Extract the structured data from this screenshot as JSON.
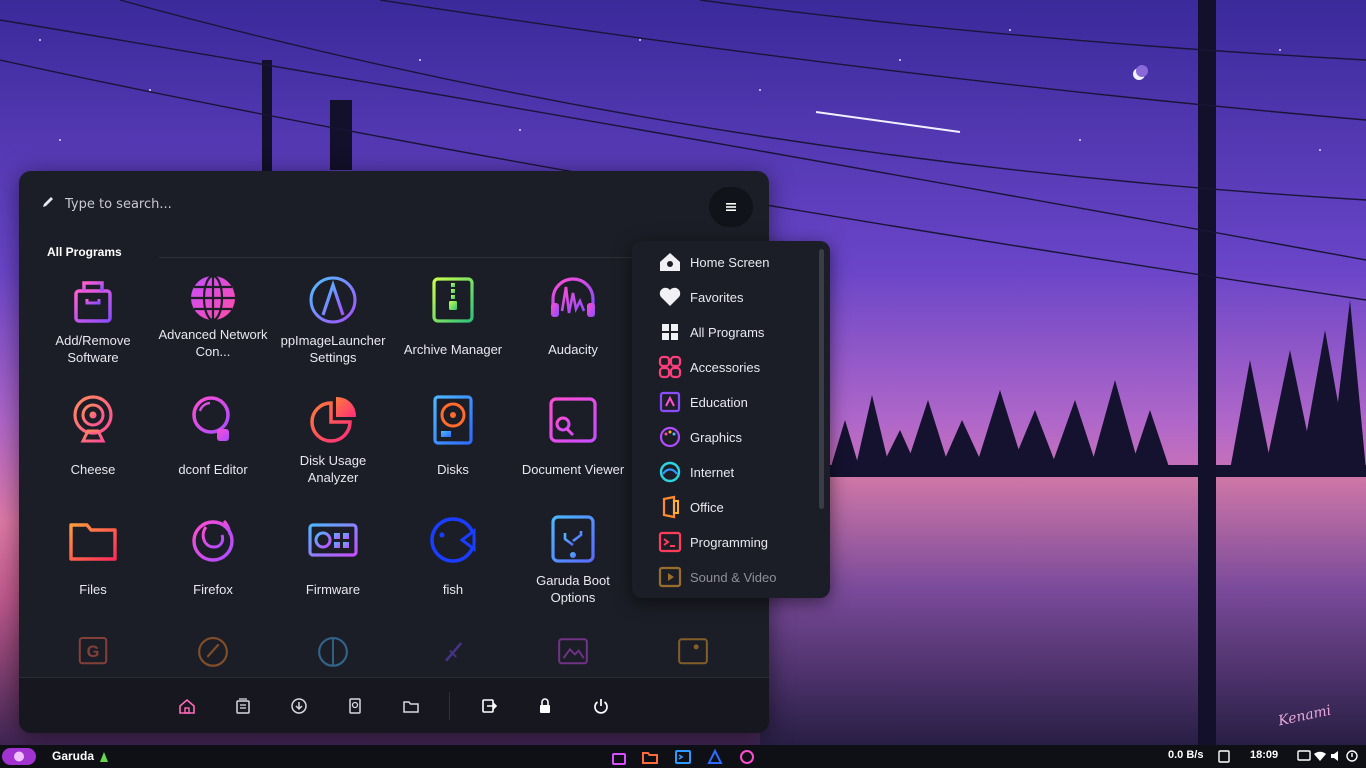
{
  "search": {
    "placeholder": "Type to search..."
  },
  "section": {
    "title": "All Programs"
  },
  "apps": [
    {
      "label": "Add/Remove Software",
      "icon": "package-bag-icon"
    },
    {
      "label": "Advanced Network Con...",
      "icon": "globe-icon"
    },
    {
      "label": "ppImageLauncher Settings",
      "icon": "appimage-a-icon"
    },
    {
      "label": "Archive Manager",
      "icon": "archive-zip-icon"
    },
    {
      "label": "Audacity",
      "icon": "headphones-waveform-icon"
    },
    {
      "label": "Cheese",
      "icon": "webcam-icon"
    },
    {
      "label": "dconf Editor",
      "icon": "dconf-magnifier-icon"
    },
    {
      "label": "Disk Usage Analyzer",
      "icon": "pie-chart-icon"
    },
    {
      "label": "Disks",
      "icon": "hard-disk-icon"
    },
    {
      "label": "Document Viewer",
      "icon": "document-viewer-icon"
    },
    {
      "label": "Files",
      "icon": "folder-icon"
    },
    {
      "label": "Firefox",
      "icon": "firefox-icon"
    },
    {
      "label": "Firmware",
      "icon": "firmware-chip-icon"
    },
    {
      "label": "fish",
      "icon": "fish-icon"
    },
    {
      "label": "Garuda Boot Options",
      "icon": "usb-boot-icon"
    }
  ],
  "categories": [
    {
      "label": "Home Screen",
      "icon": "home-icon"
    },
    {
      "label": "Favorites",
      "icon": "heart-icon"
    },
    {
      "label": "All Programs",
      "icon": "grid-icon"
    },
    {
      "label": "Accessories",
      "icon": "accessories-icon"
    },
    {
      "label": "Education",
      "icon": "education-icon"
    },
    {
      "label": "Graphics",
      "icon": "palette-icon"
    },
    {
      "label": "Internet",
      "icon": "internet-icon"
    },
    {
      "label": "Office",
      "icon": "office-icon"
    },
    {
      "label": "Programming",
      "icon": "terminal-icon"
    },
    {
      "label": "Sound & Video",
      "icon": "media-player-icon"
    }
  ],
  "bottom_bar": [
    "home-icon",
    "documents-icon",
    "downloads-icon",
    "disk-icon",
    "folder-icon",
    "logout-icon",
    "lock-icon",
    "power-icon"
  ],
  "taskbar": {
    "title": "Garuda",
    "net_speed": "0.0 B/s",
    "clock": "18:09"
  },
  "wallpaper_signature": "Kenami",
  "colors": {
    "menu_bg": "#1c1e27",
    "taskbar_bg": "#0f1015",
    "accent": "#a233d1"
  }
}
